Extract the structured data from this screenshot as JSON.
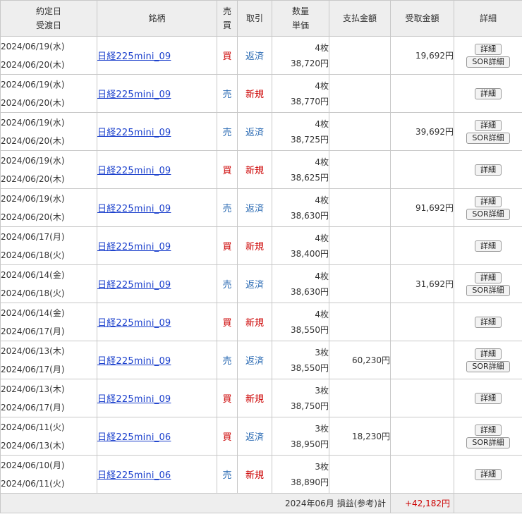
{
  "headers": {
    "date_line1": "約定日",
    "date_line2": "受渡日",
    "name": "銘柄",
    "side_line1": "売",
    "side_line2": "買",
    "type": "取引",
    "qty_line1": "数量",
    "qty_line2": "単価",
    "pay": "支払金額",
    "recv": "受取金額",
    "detail": "詳細"
  },
  "buttons": {
    "detail": "詳細",
    "sor": "SOR詳細"
  },
  "colors": {
    "buy": "#cc0000",
    "sell": "#2a6ab3",
    "link": "#1a3fcc",
    "profit": "#cc0000"
  },
  "rows": [
    {
      "trade_date": "2024/06/19(水)",
      "settle_date": "2024/06/20(木)",
      "name": "日経225mini_09",
      "side": "買",
      "side_kind": "buy",
      "type": "返済",
      "type_kind": "close",
      "qty": "4枚",
      "price": "38,720円",
      "pay": "",
      "recv": "19,692円",
      "sor": true
    },
    {
      "trade_date": "2024/06/19(水)",
      "settle_date": "2024/06/20(木)",
      "name": "日経225mini_09",
      "side": "売",
      "side_kind": "sell",
      "type": "新規",
      "type_kind": "new",
      "qty": "4枚",
      "price": "38,770円",
      "pay": "",
      "recv": "",
      "sor": false
    },
    {
      "trade_date": "2024/06/19(水)",
      "settle_date": "2024/06/20(木)",
      "name": "日経225mini_09",
      "side": "売",
      "side_kind": "sell",
      "type": "返済",
      "type_kind": "close",
      "qty": "4枚",
      "price": "38,725円",
      "pay": "",
      "recv": "39,692円",
      "sor": true
    },
    {
      "trade_date": "2024/06/19(水)",
      "settle_date": "2024/06/20(木)",
      "name": "日経225mini_09",
      "side": "買",
      "side_kind": "buy",
      "type": "新規",
      "type_kind": "new",
      "qty": "4枚",
      "price": "38,625円",
      "pay": "",
      "recv": "",
      "sor": false
    },
    {
      "trade_date": "2024/06/19(水)",
      "settle_date": "2024/06/20(木)",
      "name": "日経225mini_09",
      "side": "売",
      "side_kind": "sell",
      "type": "返済",
      "type_kind": "close",
      "qty": "4枚",
      "price": "38,630円",
      "pay": "",
      "recv": "91,692円",
      "sor": true
    },
    {
      "trade_date": "2024/06/17(月)",
      "settle_date": "2024/06/18(火)",
      "name": "日経225mini_09",
      "side": "買",
      "side_kind": "buy",
      "type": "新規",
      "type_kind": "new",
      "qty": "4枚",
      "price": "38,400円",
      "pay": "",
      "recv": "",
      "sor": false
    },
    {
      "trade_date": "2024/06/14(金)",
      "settle_date": "2024/06/18(火)",
      "name": "日経225mini_09",
      "side": "売",
      "side_kind": "sell",
      "type": "返済",
      "type_kind": "close",
      "qty": "4枚",
      "price": "38,630円",
      "pay": "",
      "recv": "31,692円",
      "sor": true
    },
    {
      "trade_date": "2024/06/14(金)",
      "settle_date": "2024/06/17(月)",
      "name": "日経225mini_09",
      "side": "買",
      "side_kind": "buy",
      "type": "新規",
      "type_kind": "new",
      "qty": "4枚",
      "price": "38,550円",
      "pay": "",
      "recv": "",
      "sor": false
    },
    {
      "trade_date": "2024/06/13(木)",
      "settle_date": "2024/06/17(月)",
      "name": "日経225mini_09",
      "side": "売",
      "side_kind": "sell",
      "type": "返済",
      "type_kind": "close",
      "qty": "3枚",
      "price": "38,550円",
      "pay": "60,230円",
      "recv": "",
      "sor": true
    },
    {
      "trade_date": "2024/06/13(木)",
      "settle_date": "2024/06/17(月)",
      "name": "日経225mini_09",
      "side": "買",
      "side_kind": "buy",
      "type": "新規",
      "type_kind": "new",
      "qty": "3枚",
      "price": "38,750円",
      "pay": "",
      "recv": "",
      "sor": false
    },
    {
      "trade_date": "2024/06/11(火)",
      "settle_date": "2024/06/13(木)",
      "name": "日経225mini_06",
      "side": "買",
      "side_kind": "buy",
      "type": "返済",
      "type_kind": "close",
      "qty": "3枚",
      "price": "38,950円",
      "pay": "18,230円",
      "recv": "",
      "sor": true
    },
    {
      "trade_date": "2024/06/10(月)",
      "settle_date": "2024/06/11(火)",
      "name": "日経225mini_06",
      "side": "売",
      "side_kind": "sell",
      "type": "新規",
      "type_kind": "new",
      "qty": "3枚",
      "price": "38,890円",
      "pay": "",
      "recv": "",
      "sor": false
    }
  ],
  "summary": {
    "label": "2024年06月 損益(参考)計",
    "value": "+42,182円"
  }
}
